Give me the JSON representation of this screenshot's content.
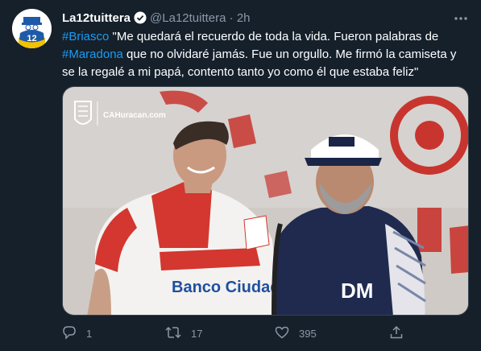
{
  "tweet": {
    "author_name": "La12tuittera",
    "handle": "@La12tuittera",
    "separator": "·",
    "time": "2h",
    "text_segments": [
      {
        "text": "#Briasco",
        "hashtag": true
      },
      {
        "text": " \"Me quedará el recuerdo de toda la vida. Fueron palabras de ",
        "hashtag": false
      },
      {
        "text": "#Maradona",
        "hashtag": true
      },
      {
        "text": " que no olvidaré jamás. Fue un orgullo. Me firmó la camiseta y se la regalé a mi papá, contento tanto yo como él que estaba feliz\"",
        "hashtag": false
      }
    ],
    "media": {
      "badge_text": "CAHuracan.com",
      "sponsor_text": "Banco Ciudad",
      "cap_text": "DM"
    },
    "actions": {
      "reply_count": "1",
      "retweet_count": "17",
      "like_count": "395"
    }
  },
  "colors": {
    "background": "#15202b",
    "hashtag": "#1d9bf0",
    "muted": "#8b98a5"
  },
  "icons": [
    "verified-icon",
    "more-icon",
    "reply-icon",
    "retweet-icon",
    "like-icon",
    "share-icon"
  ]
}
